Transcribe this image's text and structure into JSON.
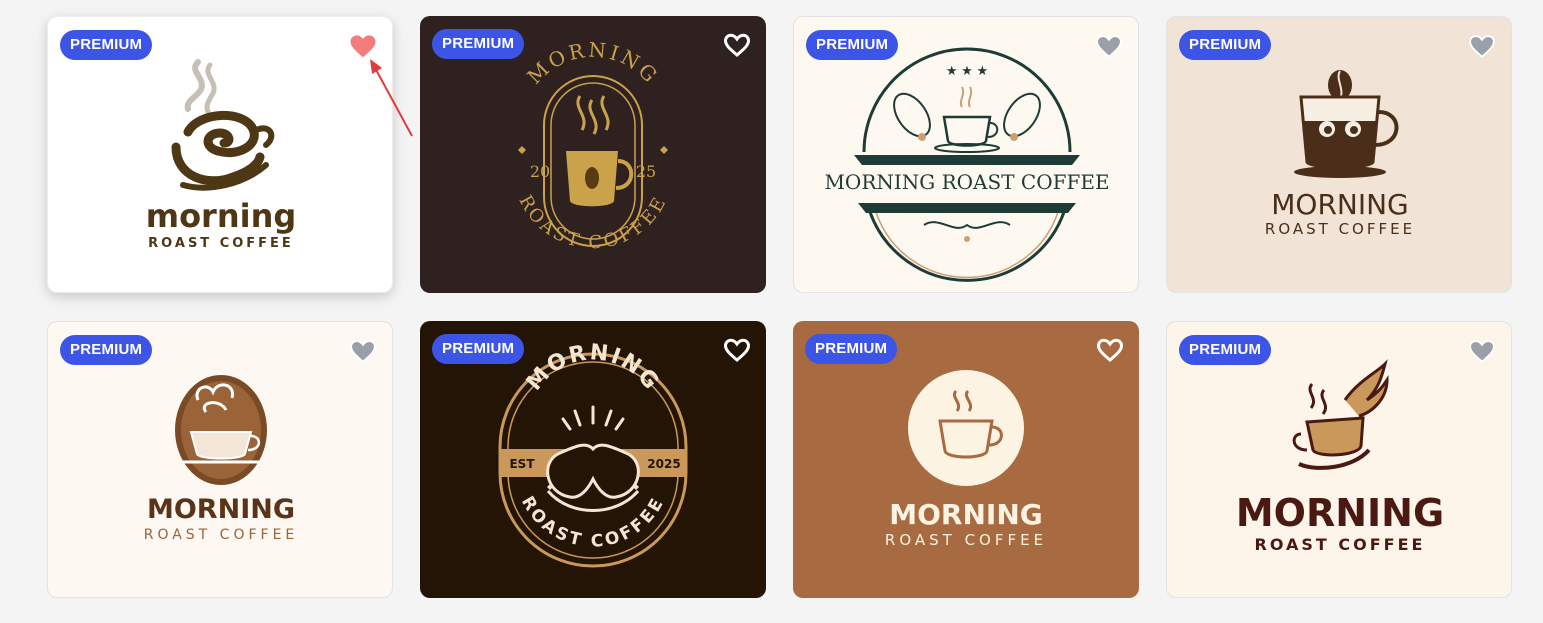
{
  "badge_label": "PREMIUM",
  "colors": {
    "badge_bg": "#3d55e6",
    "page_bg": "#f4f4f4",
    "heart_active": "#f47c7c",
    "heart_inactive": "#9aa0aa",
    "arrow": "#e23b3b"
  },
  "cards": [
    {
      "name": "logo-1",
      "bg": "#ffffff",
      "heart": "active-pink",
      "line1": "morning",
      "line2": "ROAST COFFEE",
      "top_text": "",
      "years": []
    },
    {
      "name": "logo-2",
      "bg": "#2e2120",
      "heart": "white",
      "line1": "",
      "line2": "",
      "top_text": "MORNING",
      "bottom_text": "ROAST COFFEE",
      "years": [
        "20",
        "25"
      ]
    },
    {
      "name": "logo-3",
      "bg": "#fdf9f1",
      "heart": "grey",
      "line1": "MORNING ROAST COFFEE",
      "line2": "",
      "top_text": "",
      "years": []
    },
    {
      "name": "logo-4",
      "bg": "#f1e4d6",
      "heart": "grey",
      "line1": "MORNING",
      "line2": "ROAST COFFEE",
      "top_text": "",
      "years": []
    },
    {
      "name": "logo-5",
      "bg": "#fdf8f1",
      "heart": "grey",
      "line1": "MORNING",
      "line2": "ROAST COFFEE",
      "top_text": "",
      "years": []
    },
    {
      "name": "logo-6",
      "bg": "#231405",
      "heart": "white",
      "line1": "",
      "line2": "",
      "top_text": "MORNING",
      "bottom_text": "ROAST COFFEE",
      "years": [
        "EST",
        "2025"
      ]
    },
    {
      "name": "logo-7",
      "bg": "#a86a40",
      "heart": "white",
      "line1": "MORNING",
      "line2": "ROAST COFFEE",
      "top_text": "",
      "years": []
    },
    {
      "name": "logo-8",
      "bg": "#fdf5ea",
      "heart": "grey",
      "line1": "MORNING",
      "line2": "ROAST COFFEE",
      "top_text": "",
      "years": []
    }
  ]
}
